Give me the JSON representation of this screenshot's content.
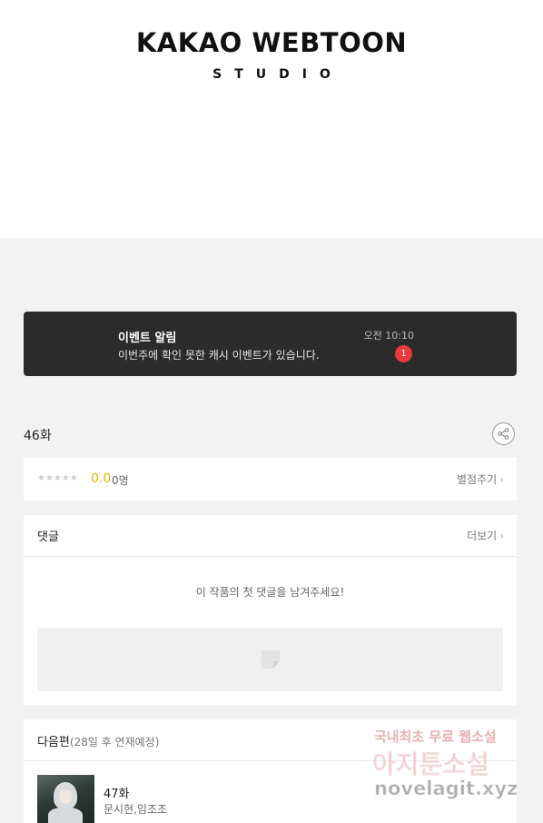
{
  "header": {
    "logo_main": "KAKAO WEBTOON",
    "logo_sub": "STUDIO"
  },
  "notification": {
    "title": "이벤트 알림",
    "message": "이번주에 확인 못한 캐시 이벤트가 있습니다.",
    "time": "오전 10:10",
    "badge_count": "1",
    "badge_color": "#e83a3a"
  },
  "episode": {
    "title": "46화"
  },
  "rating": {
    "stars": "★★★★★",
    "score": "0.0",
    "count": "0명",
    "rate_link": "별점주기",
    "score_color": "#f0b400"
  },
  "comments": {
    "title": "댓글",
    "more": "더보기",
    "empty_text": "이 작품의 첫 댓글을 남겨주세요!"
  },
  "next_episode": {
    "title": "다음편",
    "schedule": "(28일 후 연재예정)",
    "episode_label": "47화",
    "authors": "문시현,임조조"
  },
  "watermark": {
    "line1": "국내최초 무료 웹소설",
    "line2": "아지툰소설",
    "line3": "novelagit.xyz"
  },
  "icons": {
    "share": "share-icon",
    "chevron": "chevron-right-icon",
    "comment_input": "comment-icon"
  }
}
